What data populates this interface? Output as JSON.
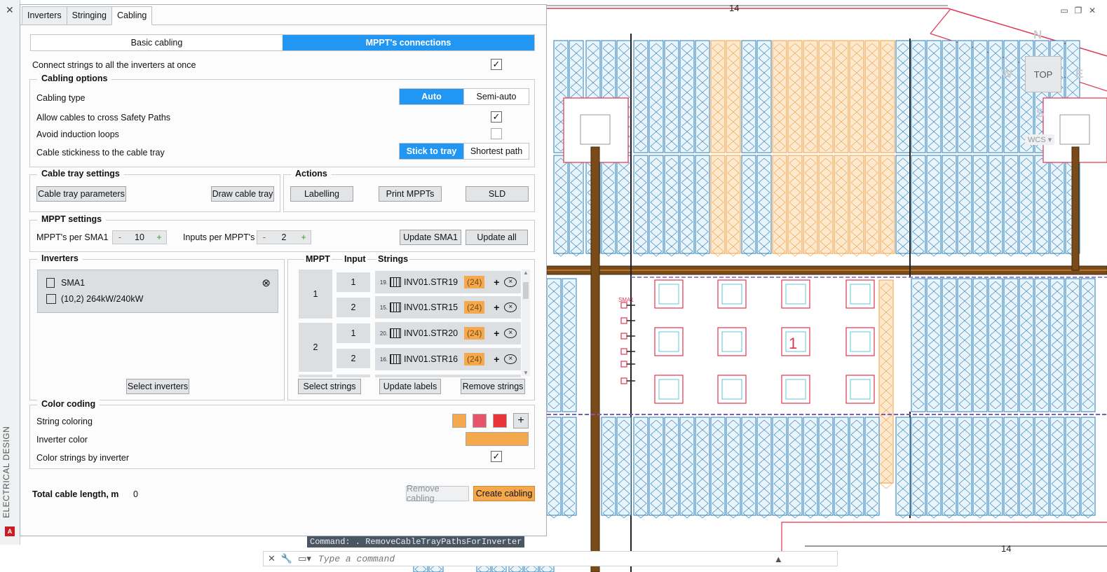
{
  "side": {
    "title": "ELECTRICAL DESIGN",
    "close": "✕",
    "logo": "A"
  },
  "tabs": [
    {
      "label": "Inverters"
    },
    {
      "label": "Stringing"
    },
    {
      "label": "Cabling"
    }
  ],
  "mode": {
    "basic": "Basic cabling",
    "mppt": "MPPT's connections",
    "active": "mppt"
  },
  "connect_all": {
    "label": "Connect strings to all the inverters at once",
    "checked": true
  },
  "cabling_options": {
    "title": "Cabling options",
    "type_label": "Cabling type",
    "type_auto": "Auto",
    "type_semi": "Semi-auto",
    "cross_label": "Allow cables to cross Safety Paths",
    "cross_checked": true,
    "loops_label": "Avoid induction loops",
    "loops_checked": false,
    "stick_label": "Cable stickiness to the cable tray",
    "stick_tray": "Stick to tray",
    "stick_short": "Shortest path"
  },
  "tray": {
    "title": "Cable tray settings",
    "params_btn": "Cable tray parameters",
    "draw_btn": "Draw cable tray"
  },
  "actions": {
    "title": "Actions",
    "labelling_btn": "Labelling",
    "print_btn": "Print MPPTs",
    "sld_btn": "SLD"
  },
  "mppt_settings": {
    "title": "MPPT settings",
    "per_label": "MPPT's per SMA1",
    "per_value": "10",
    "inputs_label": "Inputs per MPPT's",
    "inputs_value": "2",
    "minus": "-",
    "plus": "+",
    "update_btn": "Update SMA1",
    "update_all_btn": "Update all"
  },
  "inverters": {
    "title": "Inverters",
    "name": "SMA1",
    "detail": "(10,2)  264kW/240kW",
    "remove": "⊗",
    "select_btn": "Select inverters"
  },
  "mppt_table": {
    "hdr_mppt": "MPPT",
    "hdr_input": "Input",
    "hdr_strings": "Strings",
    "groups": [
      {
        "mppt": "1"
      },
      {
        "mppt": "2"
      }
    ],
    "rows": [
      {
        "input": "1",
        "idx": "19.",
        "name": "INV01.STR19",
        "count": "(24)"
      },
      {
        "input": "2",
        "idx": "15.",
        "name": "INV01.STR15",
        "count": "(24)"
      },
      {
        "input": "1",
        "idx": "20.",
        "name": "INV01.STR20",
        "count": "(24)"
      },
      {
        "input": "2",
        "idx": "16.",
        "name": "INV01.STR16",
        "count": "(24)"
      }
    ],
    "add": "+",
    "remove": "⊗",
    "select_btn": "Select strings",
    "update_labels_btn": "Update labels",
    "remove_btn": "Remove strings"
  },
  "color_coding": {
    "title": "Color coding",
    "string_label": "String coloring",
    "add": "+",
    "swatches": [
      "#f5a94e",
      "#e8556a",
      "#e8343a"
    ],
    "inverter_label": "Inverter color",
    "inverter_color": "#f5a94e",
    "by_inverter_label": "Color strings by inverter",
    "by_inverter_checked": true
  },
  "footer": {
    "total_label": "Total cable length, m",
    "total_value": "0",
    "remove_btn": "Remove cabling",
    "create_btn": "Create cabling"
  },
  "cad": {
    "top_dim": "14",
    "bottom_dim": "14",
    "zone": "1",
    "viewcube": {
      "top": "TOP",
      "n": "N",
      "w": "W",
      "e": "E",
      "s": "S"
    },
    "wcs": "WCS ▾",
    "cmd_history": "Command: . RemoveCableTrayPathsForInverter",
    "cmd_placeholder": "Type a command",
    "sma_tag": "SMA1"
  }
}
